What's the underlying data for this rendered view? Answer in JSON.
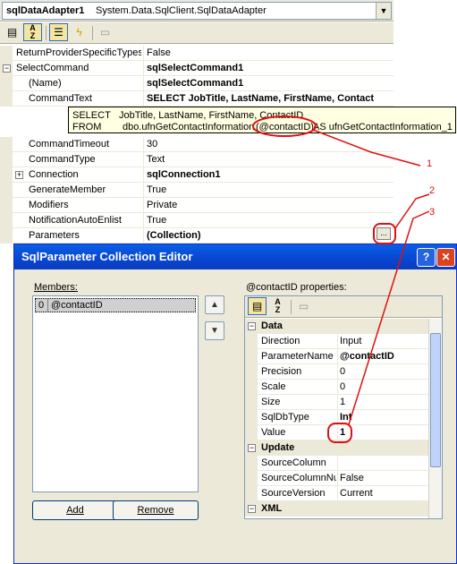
{
  "properties_window": {
    "object_name": "sqlDataAdapter1",
    "object_type": "System.Data.SqlClient.SqlDataAdapter",
    "toolbar_icons": [
      "categorized-icon",
      "alphabetical-icon",
      "properties-icon",
      "events-icon",
      "property-pages-icon"
    ],
    "rows": [
      {
        "name": "ReturnProviderSpecificTypes",
        "value": "False"
      },
      {
        "name": "SelectCommand",
        "value": "sqlSelectCommand1",
        "expanded": true
      },
      {
        "name": "(Name)",
        "value": "sqlSelectCommand1"
      },
      {
        "name": "CommandText",
        "value": "SELECT     JobTitle, LastName, FirstName, Contact"
      },
      {
        "name": "CommandTimeout",
        "value": "30"
      },
      {
        "name": "CommandType",
        "value": "Text"
      },
      {
        "name": "Connection",
        "value": "sqlConnection1",
        "collapsed": true
      },
      {
        "name": "GenerateMember",
        "value": "True"
      },
      {
        "name": "Modifiers",
        "value": "Private"
      },
      {
        "name": "NotificationAutoEnlist",
        "value": "True"
      },
      {
        "name": "Parameters",
        "value": "(Collection)"
      }
    ],
    "tooltip": {
      "line1_keyword": "SELECT",
      "line1_text": "JobTitle, LastName, FirstName, ContactID",
      "line2_keyword": "FROM",
      "line2_function": "dbo.ufnGetContactInformation",
      "line2_param": "(@contactID)",
      "line2_alias": "AS ufnGetContactInformation_1"
    },
    "ellipsis_label": "..."
  },
  "dialog": {
    "title": "SqlParameter Collection Editor",
    "help_label": "?",
    "close_label": "✕",
    "members_label": "Members:",
    "members": [
      {
        "index": "0",
        "name": "@contactID"
      }
    ],
    "move_up_label": "▲",
    "move_down_label": "▼",
    "properties_label": "@contactID properties:",
    "property_rows": [
      {
        "category": true,
        "name": "Data",
        "sign": "−"
      },
      {
        "name": "Direction",
        "value": "Input"
      },
      {
        "name": "ParameterName",
        "value": "@contactID"
      },
      {
        "name": "Precision",
        "value": "0"
      },
      {
        "name": "Scale",
        "value": "0"
      },
      {
        "name": "Size",
        "value": "1"
      },
      {
        "name": "SqlDbType",
        "value": "Int"
      },
      {
        "name": "Value",
        "value": "1"
      },
      {
        "category": true,
        "name": "Update",
        "sign": "−"
      },
      {
        "name": "SourceColumn",
        "value": ""
      },
      {
        "name": "SourceColumnNul",
        "value": "False"
      },
      {
        "name": "SourceVersion",
        "value": "Current"
      },
      {
        "category": true,
        "name": "XML",
        "sign": "−"
      }
    ],
    "add_label": "Add",
    "remove_label": "Remove"
  },
  "annotations": {
    "label1": "1",
    "label2": "2",
    "label3": "3",
    "color": "#e01010"
  }
}
